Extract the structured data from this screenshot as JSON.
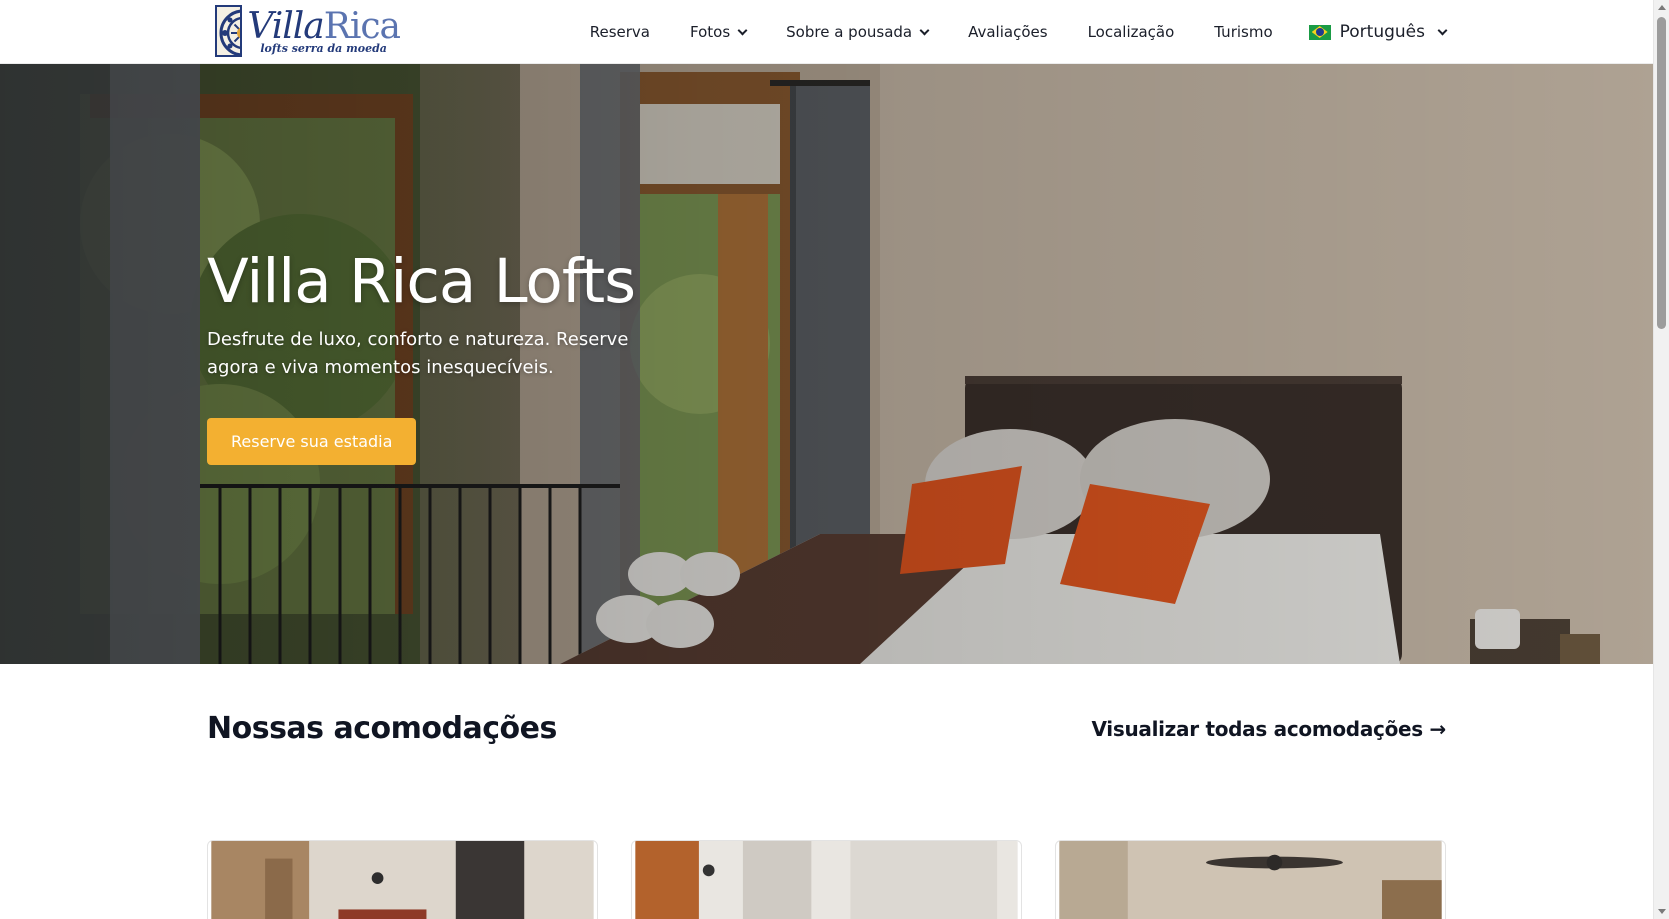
{
  "nav": {
    "logo": {
      "word_villa": "Villa",
      "word_rica": "Rica",
      "tagline": "lofts serra da moeda"
    },
    "items": [
      {
        "label": "Reserva",
        "has_dropdown": false
      },
      {
        "label": "Fotos",
        "has_dropdown": true
      },
      {
        "label": "Sobre a pousada",
        "has_dropdown": true
      },
      {
        "label": "Avaliações",
        "has_dropdown": false
      },
      {
        "label": "Localização",
        "has_dropdown": false
      },
      {
        "label": "Turismo",
        "has_dropdown": false
      }
    ],
    "language": {
      "label": "Português",
      "flag": "brazil-flag-icon"
    }
  },
  "hero": {
    "title": "Villa Rica Lofts",
    "subtitle": "Desfrute de luxo, conforto e natureza. Reserve agora e viva momentos inesquecíveis.",
    "cta_label": "Reserve sua estadia",
    "cta_color": "#f3b031"
  },
  "accommodations": {
    "title": "Nossas acomodações",
    "view_all_label": "Visualizar todas acomodações →"
  }
}
